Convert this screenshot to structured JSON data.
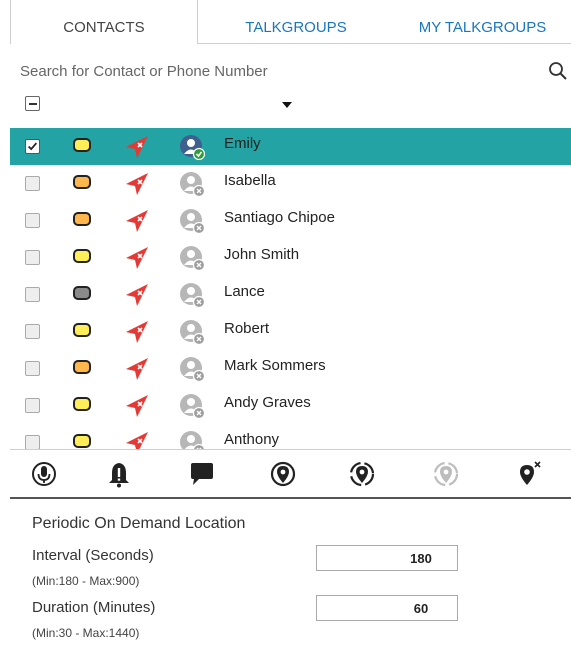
{
  "tabs": [
    {
      "label": "CONTACTS",
      "active": true
    },
    {
      "label": "TALKGROUPS",
      "active": false
    },
    {
      "label": "MY TALKGROUPS",
      "active": false
    }
  ],
  "search": {
    "placeholder": "Search for Contact or Phone Number",
    "icon": "search-icon"
  },
  "list_header": {
    "select_all": "indeterminate",
    "sort_icon": "caret-down-icon"
  },
  "contacts": [
    {
      "name": "Emily",
      "checked": true,
      "selected": true,
      "status_color": "#ffee58",
      "presence": "online"
    },
    {
      "name": "Isabella",
      "checked": false,
      "selected": false,
      "status_color": "#ffb74d",
      "presence": "offline"
    },
    {
      "name": "Santiago Chipoe",
      "checked": false,
      "selected": false,
      "status_color": "#ffb74d",
      "presence": "offline"
    },
    {
      "name": "John Smith",
      "checked": false,
      "selected": false,
      "status_color": "#ffee58",
      "presence": "offline"
    },
    {
      "name": "Lance",
      "checked": false,
      "selected": false,
      "status_color": "#8a8a8a",
      "presence": "offline"
    },
    {
      "name": "Robert",
      "checked": false,
      "selected": false,
      "status_color": "#ffee58",
      "presence": "offline"
    },
    {
      "name": "Mark Sommers",
      "checked": false,
      "selected": false,
      "status_color": "#ffb74d",
      "presence": "offline"
    },
    {
      "name": "Andy Graves",
      "checked": false,
      "selected": false,
      "status_color": "#ffee58",
      "presence": "offline"
    },
    {
      "name": "Anthony",
      "checked": false,
      "selected": false,
      "status_color": "#ffee58",
      "presence": "offline"
    }
  ],
  "toolbar": [
    {
      "icon": "microphone-icon",
      "enabled": true
    },
    {
      "icon": "alert-bell-icon",
      "enabled": true
    },
    {
      "icon": "message-icon",
      "enabled": true
    },
    {
      "icon": "locate-icon",
      "enabled": true
    },
    {
      "icon": "periodic-locate-icon",
      "enabled": true
    },
    {
      "icon": "stop-periodic-locate-icon",
      "enabled": false
    },
    {
      "icon": "clear-location-icon",
      "enabled": true
    }
  ],
  "periodic": {
    "title": "Periodic On Demand Location",
    "interval_label": "Interval (Seconds)",
    "interval_hint": "(Min:180 - Max:900)",
    "interval_value": "180",
    "duration_label": "Duration (Minutes)",
    "duration_hint": "(Min:30 - Max:1440)",
    "duration_value": "60"
  },
  "colors": {
    "accent": "#1976c2",
    "selected_row": "#23a3a3",
    "location_arrow": "#e53935",
    "online_badge": "#2e9b3a"
  }
}
